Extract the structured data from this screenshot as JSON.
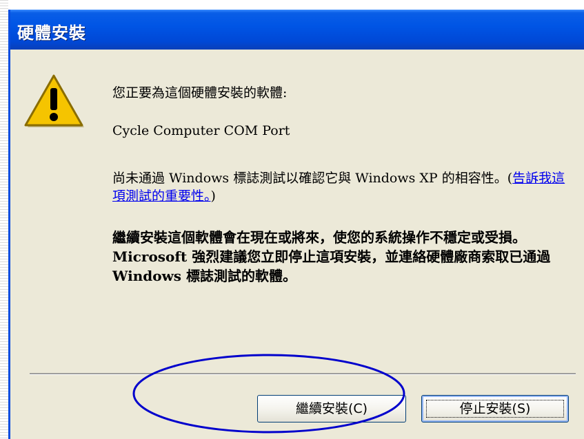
{
  "dialog": {
    "title": "硬體安裝",
    "icon": "warning-icon",
    "intro": "您正要為這個硬體安裝的軟體:",
    "device_name": "Cycle Computer COM Port",
    "compat_text": "尚未通過 Windows 標誌測試以確認它與 Windows XP 的相容性。(",
    "help_link": "告訴我這項測試的重要性。",
    "compat_close": ")",
    "warning": "繼續安裝這個軟體會在現在或將來，使您的系統操作不穩定或受損。Microsoft 強烈建議您立即停止這項安裝，並連絡硬體廠商索取已通過 Windows 標誌測試的軟體。"
  },
  "buttons": {
    "continue_label": "繼續安裝(C)",
    "stop_label": "停止安裝(S)"
  },
  "colors": {
    "titlebar": "#0055e5",
    "dialog_bg": "#ece9d8",
    "annotation": "#0000cc",
    "warning_icon": "#f5c400"
  }
}
